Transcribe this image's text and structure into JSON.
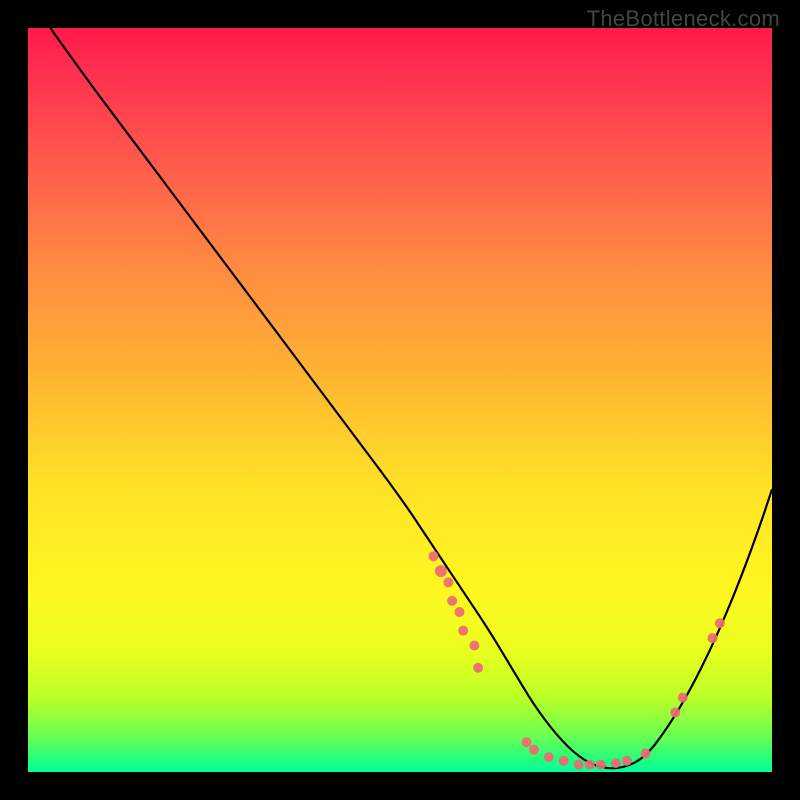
{
  "watermark": "TheBottleneck.com",
  "chart_data": {
    "type": "line",
    "title": "",
    "xlabel": "",
    "ylabel": "",
    "xlim": [
      0,
      100
    ],
    "ylim": [
      0,
      100
    ],
    "curve": {
      "name": "bottleneck-curve",
      "x": [
        3,
        8,
        14,
        20,
        26,
        32,
        38,
        44,
        50,
        54,
        58,
        62,
        65,
        68,
        71,
        74,
        77,
        80,
        83,
        86,
        89,
        92,
        95,
        98,
        100
      ],
      "y": [
        100,
        93,
        85,
        77,
        69,
        61,
        53,
        45,
        37,
        31,
        25,
        19,
        14,
        9,
        5,
        2,
        0.5,
        0.5,
        2,
        6,
        11,
        17,
        24,
        32,
        38
      ]
    },
    "markers": {
      "name": "highlight-points",
      "color": "#ed6a73",
      "points": [
        {
          "x": 54.5,
          "y": 29,
          "r": 5
        },
        {
          "x": 55.5,
          "y": 27,
          "r": 6
        },
        {
          "x": 56.5,
          "y": 25.5,
          "r": 5
        },
        {
          "x": 57,
          "y": 23,
          "r": 5
        },
        {
          "x": 58,
          "y": 21.5,
          "r": 5
        },
        {
          "x": 58.5,
          "y": 19,
          "r": 5
        },
        {
          "x": 60,
          "y": 17,
          "r": 5
        },
        {
          "x": 60.5,
          "y": 14,
          "r": 5
        },
        {
          "x": 67,
          "y": 4,
          "r": 5
        },
        {
          "x": 68,
          "y": 3,
          "r": 5
        },
        {
          "x": 70,
          "y": 2,
          "r": 5
        },
        {
          "x": 72,
          "y": 1.5,
          "r": 5
        },
        {
          "x": 74,
          "y": 1,
          "r": 5
        },
        {
          "x": 75.5,
          "y": 1,
          "r": 5
        },
        {
          "x": 77,
          "y": 1,
          "r": 5
        },
        {
          "x": 79,
          "y": 1.2,
          "r": 5
        },
        {
          "x": 80.5,
          "y": 1.5,
          "r": 5
        },
        {
          "x": 83,
          "y": 2.5,
          "r": 5
        },
        {
          "x": 87,
          "y": 8,
          "r": 5
        },
        {
          "x": 88,
          "y": 10,
          "r": 5
        },
        {
          "x": 92,
          "y": 18,
          "r": 5
        },
        {
          "x": 93,
          "y": 20,
          "r": 5
        }
      ]
    },
    "gradient_stops": [
      {
        "pos": 0,
        "color": "#ff1a4a"
      },
      {
        "pos": 18,
        "color": "#ff5a4c"
      },
      {
        "pos": 46,
        "color": "#ffb233"
      },
      {
        "pos": 76,
        "color": "#fff81f"
      },
      {
        "pos": 95,
        "color": "#6dff50"
      },
      {
        "pos": 100,
        "color": "#00ff9a"
      }
    ]
  }
}
